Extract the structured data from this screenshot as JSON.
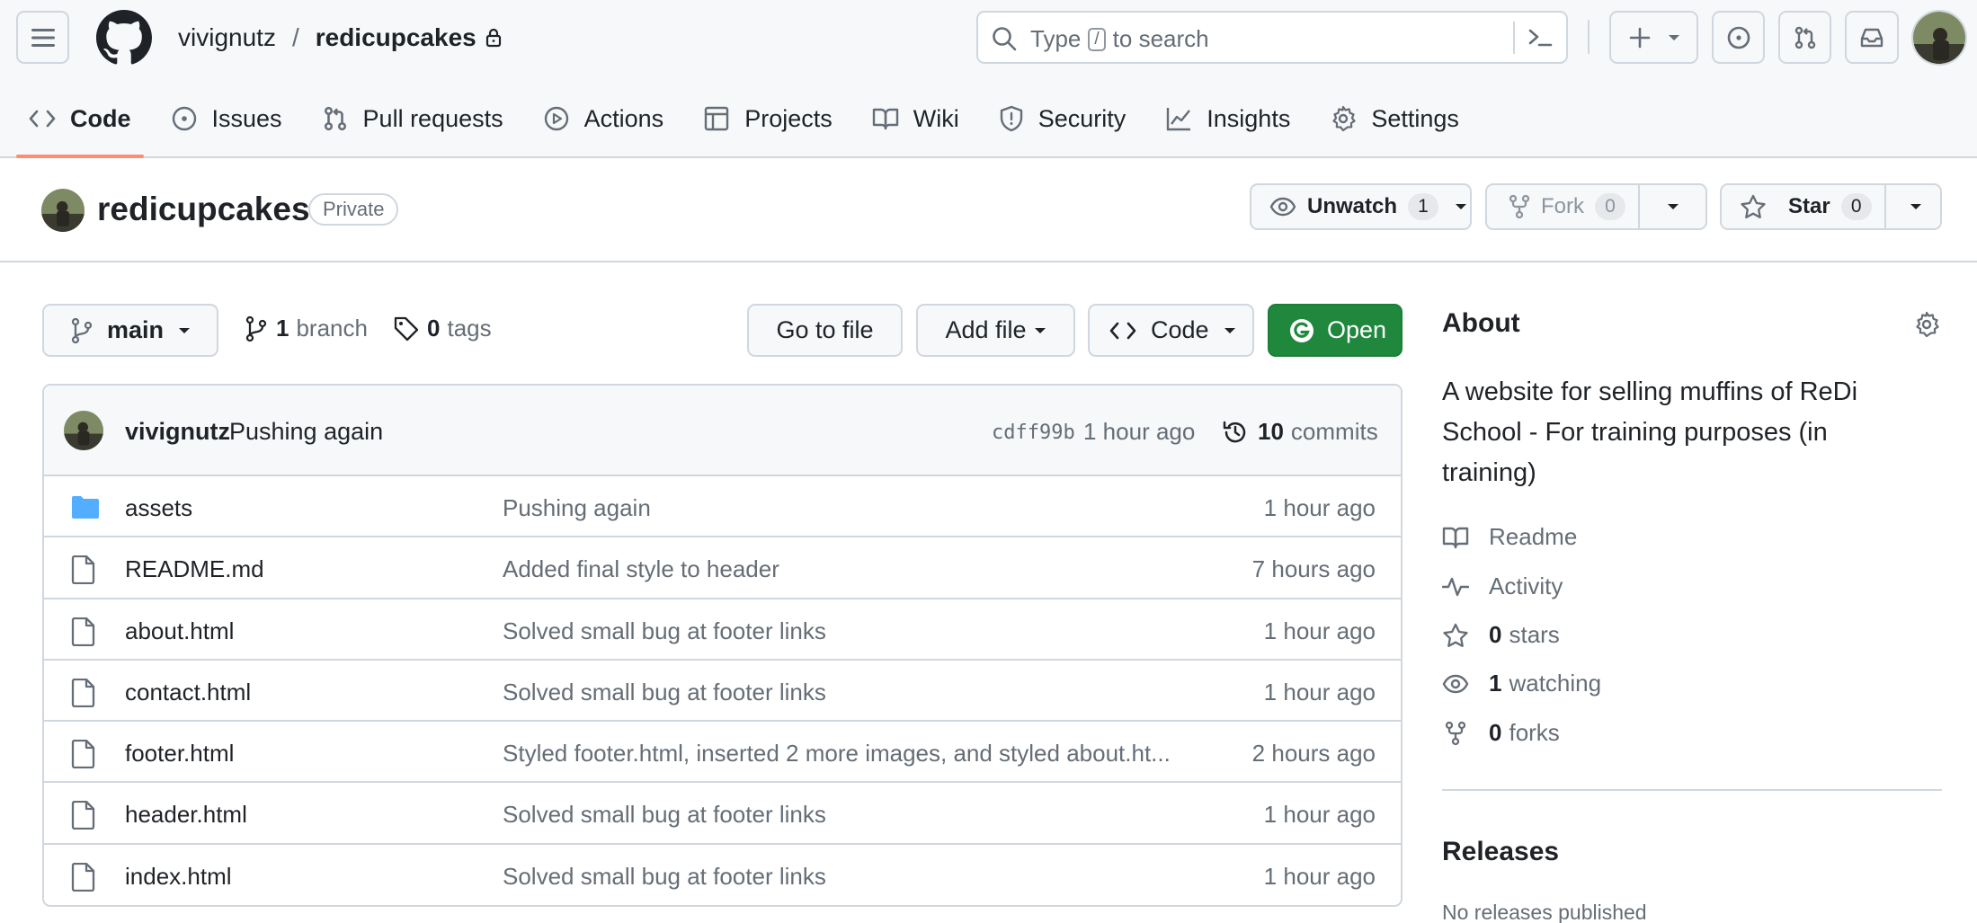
{
  "header": {
    "owner": "vivignutz",
    "separator": "/",
    "repo": "redicupcakes",
    "search_prefix": "Type",
    "search_key": "/",
    "search_suffix": "to search"
  },
  "tabs": [
    {
      "label": "Code",
      "icon": "code-icon",
      "active": true
    },
    {
      "label": "Issues",
      "icon": "issue-icon"
    },
    {
      "label": "Pull requests",
      "icon": "pull-request-icon"
    },
    {
      "label": "Actions",
      "icon": "play-icon"
    },
    {
      "label": "Projects",
      "icon": "table-icon"
    },
    {
      "label": "Wiki",
      "icon": "book-icon"
    },
    {
      "label": "Security",
      "icon": "shield-icon"
    },
    {
      "label": "Insights",
      "icon": "graph-icon"
    },
    {
      "label": "Settings",
      "icon": "gear-icon"
    }
  ],
  "repo": {
    "name": "redicupcakes",
    "visibility": "Private",
    "watch_label": "Unwatch",
    "watch_count": "1",
    "fork_label": "Fork",
    "fork_count": "0",
    "star_label": "Star",
    "star_count": "0"
  },
  "branchbar": {
    "branch": "main",
    "branch_count": "1",
    "branch_word": "branch",
    "tag_count": "0",
    "tag_word": "tags",
    "goto_file": "Go to file",
    "add_file": "Add file",
    "code": "Code",
    "open": "Open"
  },
  "commit": {
    "user": "vivignutz",
    "message": "Pushing again",
    "sha": "cdff99b",
    "time": "1 hour ago",
    "count": "10",
    "count_word": "commits"
  },
  "files": [
    {
      "name": "assets",
      "type": "folder",
      "message": "Pushing again",
      "time": "1 hour ago"
    },
    {
      "name": "README.md",
      "type": "file",
      "message": "Added final style to header",
      "time": "7 hours ago"
    },
    {
      "name": "about.html",
      "type": "file",
      "message": "Solved small bug at footer links",
      "time": "1 hour ago"
    },
    {
      "name": "contact.html",
      "type": "file",
      "message": "Solved small bug at footer links",
      "time": "1 hour ago"
    },
    {
      "name": "footer.html",
      "type": "file",
      "message": "Styled footer.html, inserted 2 more images, and styled about.ht...",
      "time": "2 hours ago"
    },
    {
      "name": "header.html",
      "type": "file",
      "message": "Solved small bug at footer links",
      "time": "1 hour ago"
    },
    {
      "name": "index.html",
      "type": "file",
      "message": "Solved small bug at footer links",
      "time": "1 hour ago"
    }
  ],
  "about": {
    "title": "About",
    "description": "A website for selling muffins of ReDi School - For training purposes (in training)",
    "readme": "Readme",
    "activity": "Activity",
    "stars_count": "0",
    "stars_word": "stars",
    "watching_count": "1",
    "watching_word": "watching",
    "forks_count": "0",
    "forks_word": "forks"
  },
  "releases": {
    "title": "Releases",
    "none": "No releases published"
  },
  "colors": {
    "accent_underline": "#fd8c73",
    "open_button": "#1f883d",
    "folder": "#54aeff"
  }
}
